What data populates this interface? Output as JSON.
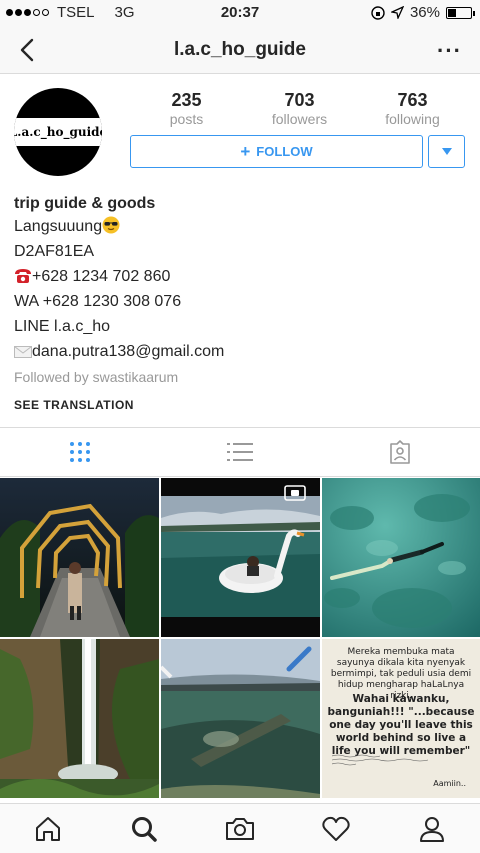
{
  "status_bar": {
    "carrier": "TSEL",
    "network": "3G",
    "time": "20:37",
    "battery": "36%"
  },
  "nav": {
    "username": "l.a.c_ho_guide",
    "more_icon": "ellipsis-icon"
  },
  "profile": {
    "avatar_text": "L.a.c_ho_guide",
    "stats": [
      {
        "value": "235",
        "label": "posts"
      },
      {
        "value": "703",
        "label": "followers"
      },
      {
        "value": "763",
        "label": "following"
      }
    ],
    "follow_label": "FOLLOW"
  },
  "bio": {
    "name": "trip guide & goods",
    "line1": "Langsuuung",
    "line2": "D2AF81EA",
    "phone": "+628 1234 702 860",
    "wa": "WA +628 1230 308 076",
    "line": "LINE l.a.c_ho",
    "email": "dana.putra138@gmail.com",
    "followed_by": "Followed by swastikaarum",
    "see_translation": "SEE TRANSLATION"
  },
  "colors": {
    "accent": "#3897f0",
    "muted": "#999999",
    "divider": "#dbdbdb"
  },
  "posts": {
    "quote": {
      "small": "Mereka membuka mata sayunya dikala kita nyenyak bermimpi, tak peduli usia demi hidup mengharap haLaLnya rizki.",
      "big": "Wahai kawanku, banguniah!!! \"...because one day you'll leave this world behind so live a life you will remember\"",
      "amin": "Aamiin.."
    }
  },
  "bottom_nav": [
    "home-icon",
    "search-icon",
    "camera-icon",
    "heart-icon",
    "profile-icon"
  ]
}
